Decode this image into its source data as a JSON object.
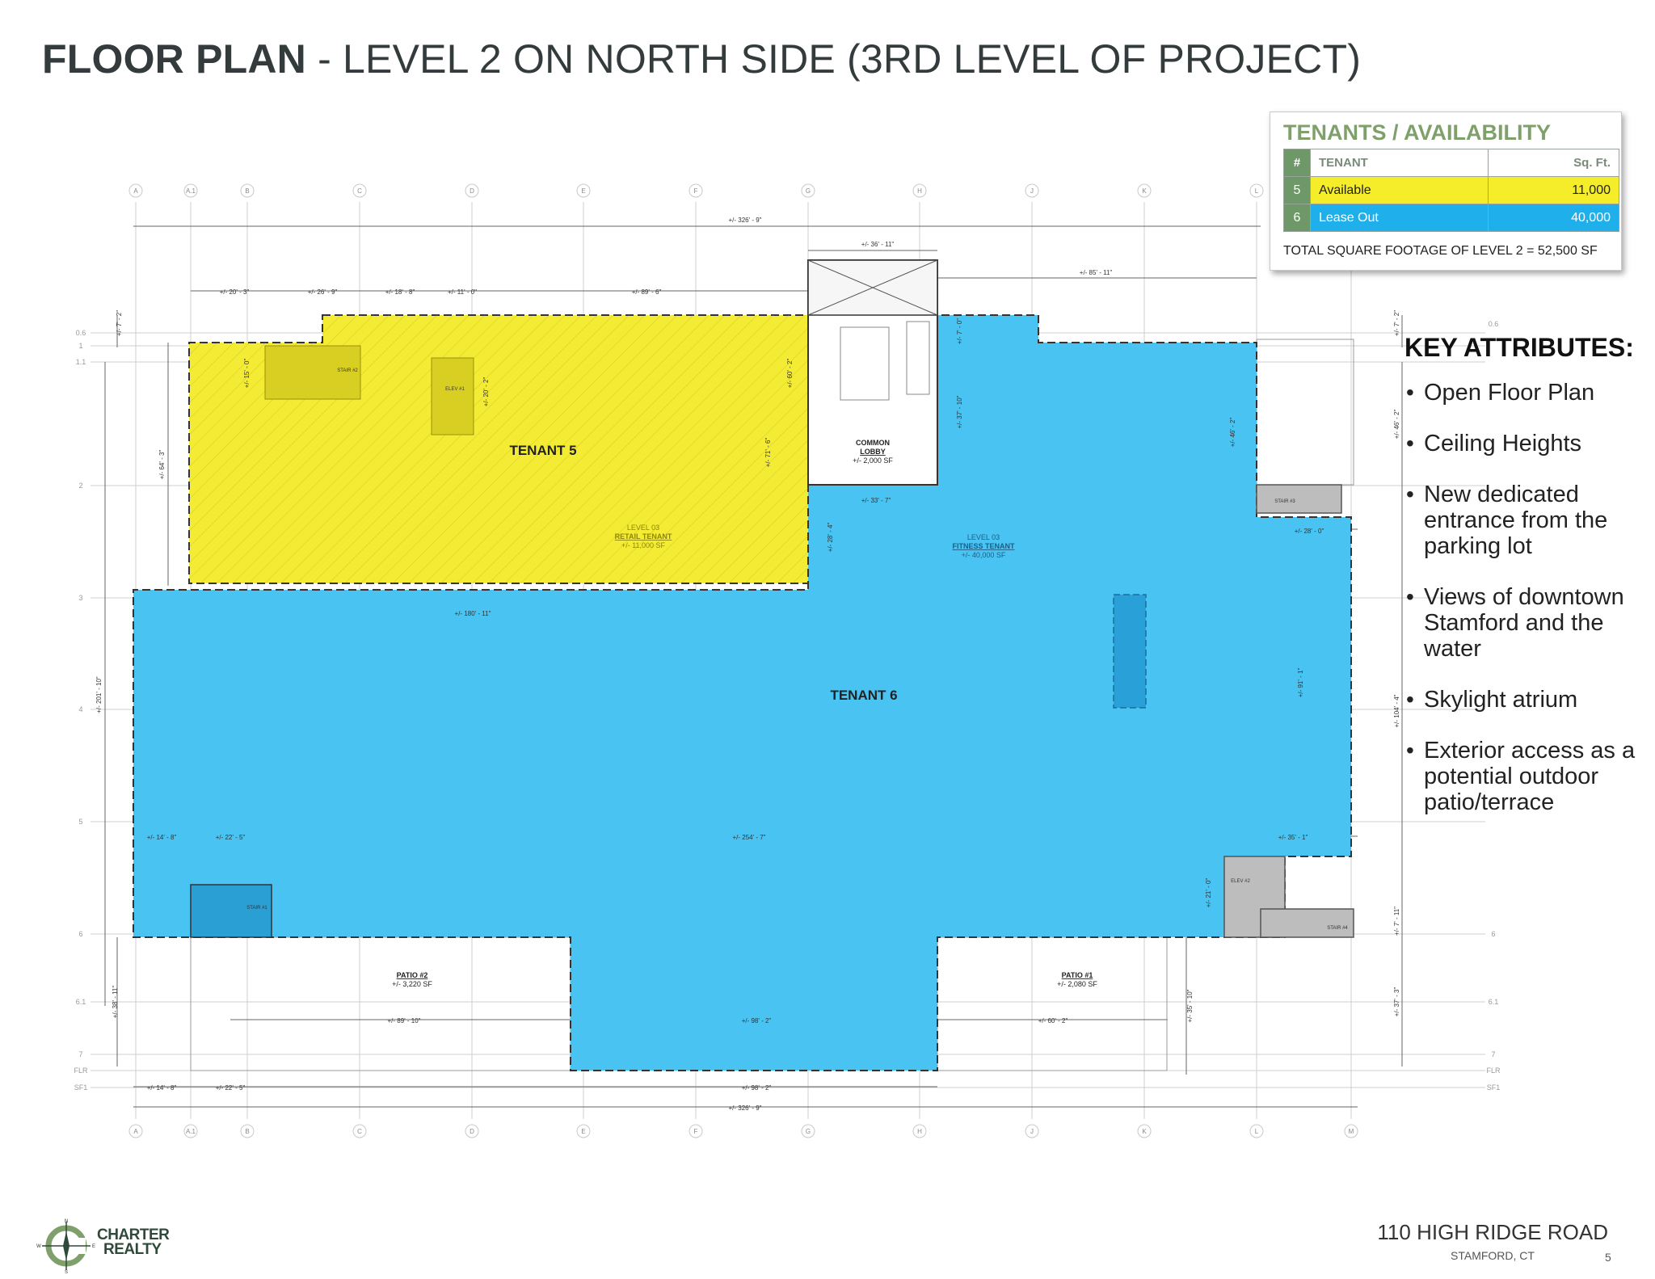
{
  "header": {
    "title_bold": "FLOOR PLAN",
    "title_rest": " - LEVEL 2 ON NORTH SIDE (3RD LEVEL OF PROJECT)"
  },
  "tenants_box": {
    "title": "TENANTS / AVAILABILITY",
    "columns": [
      "#",
      "TENANT",
      "Sq. Ft."
    ],
    "rows": [
      {
        "num": "5",
        "tenant": "Available",
        "sqft": "11,000",
        "color": "#f5ec2a"
      },
      {
        "num": "6",
        "tenant": "Lease Out",
        "sqft": "40,000",
        "color": "#1fb0ec"
      }
    ],
    "total": "TOTAL SQUARE FOOTAGE OF LEVEL 2 = 52,500 SF"
  },
  "key_attributes": {
    "title": "KEY ATTRIBUTES:",
    "items": [
      "Open Floor Plan",
      "Ceiling Heights",
      "New dedicated entrance from the parking lot",
      "Views of downtown Stamford and the water",
      "Skylight atrium",
      "Exterior access as a potential outdoor patio/terrace"
    ]
  },
  "plan": {
    "tenant5_label": "TENANT 5",
    "tenant6_label": "TENANT 6",
    "tenant5_sub": [
      "LEVEL 03",
      "RETAIL TENANT",
      "+/- 11,000 SF"
    ],
    "tenant6_sub": [
      "LEVEL 03",
      "FITNESS TENANT",
      "+/- 40,000 SF"
    ],
    "lobby": [
      "COMMON",
      "LOBBY",
      "+/- 2,000 SF"
    ],
    "patio2": [
      "PATIO #2",
      "+/- 3,220 SF"
    ],
    "patio1": [
      "PATIO #1",
      "+/- 2,080 SF"
    ],
    "stair_labels": [
      "STAIR #3",
      "STAIR #2",
      "STAIR #4",
      "STAIR #1"
    ],
    "elev_labels": [
      "ELEV #1",
      "ELEV #2"
    ],
    "grid_cols": [
      "A",
      "A.1",
      "B",
      "C",
      "D",
      "E",
      "F",
      "G",
      "H",
      "J",
      "K",
      "L",
      "M"
    ],
    "grid_rows_left": [
      "0.6",
      "1",
      "1.1",
      "2",
      "3",
      "4",
      "5",
      "6",
      "6.1",
      "7",
      "FLR",
      "SF1"
    ],
    "grid_rows_right": [
      "0.6",
      "6",
      "6.1",
      "7",
      "FLR",
      "SF1"
    ],
    "dims": {
      "top_overall": "+/- 326' - 9\"",
      "bottom_overall": "+/- 326' - 9\"",
      "top_seg": [
        "+/- 20' - 3\"",
        "+/- 26' - 9\"",
        "+/- 18' - 8\"",
        "+/- 11' - 0\"",
        "+/- 89' - 6\""
      ],
      "lobby_w": "+/- 36' - 11\"",
      "right_top": "+/- 85' - 11\"",
      "lobby_lower": "+/- 33' - 7\"",
      "right_mid": "+/- 28' - 0\"",
      "mid_180": "+/- 180' - 11\"",
      "row5": [
        "+/- 14' - 8\"",
        "+/- 22' - 5\"",
        "+/- 254' - 7\"",
        "+/- 35' - 1\""
      ],
      "patio_row": [
        "+/- 89' - 10\"",
        "+/- 98' - 2\"",
        "+/- 60' - 2\""
      ],
      "bottom_seg": [
        "+/- 14' - 8\"",
        "+/- 22' - 5\"",
        "+/- 98' - 2\""
      ],
      "left_v": [
        "+/- 7' - 2\"",
        "+/- 64' - 3\"",
        "+/- 201' - 10\"",
        "+/- 38' - 11\""
      ],
      "inner_v": [
        "+/- 15' - 0\"",
        "+/- 20' - 2\"",
        "+/- 71' - 6\"",
        "+/- 60' - 2\"",
        "+/- 28' - 4\"",
        "+/- 7' - 0\"",
        "+/- 37' - 10\"",
        "+/- 46' - 2\"",
        "+/- 91' - 1\"",
        "+/- 21' - 0\"",
        "+/- 35' - 10\""
      ],
      "right_v": [
        "+/- 7' - 2\"",
        "+/- 46' - 2\"",
        "+/- 104' - 4\"",
        "+/- 7' - 11\"",
        "+/- 37' - 3\""
      ]
    }
  },
  "footer": {
    "logo_line1": "CHARTER",
    "logo_line2": "REALTY",
    "compass": [
      "N",
      "W",
      "E",
      "S"
    ],
    "address": "110 HIGH RIDGE ROAD",
    "city": "STAMFORD, CT",
    "page": "5"
  }
}
